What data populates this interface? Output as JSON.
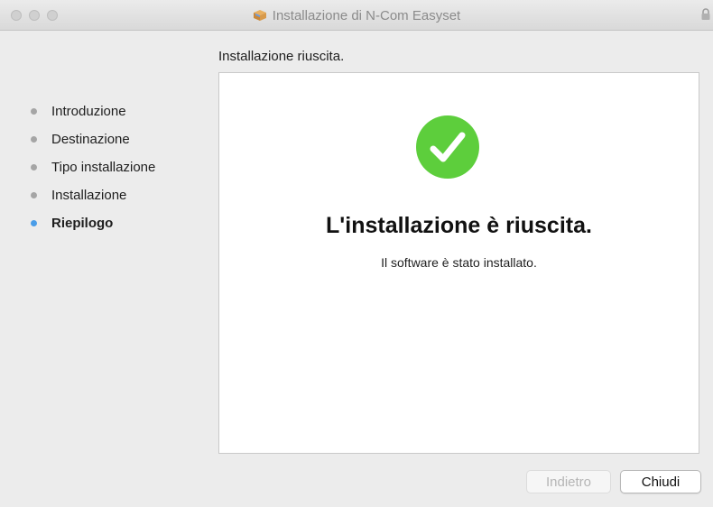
{
  "window": {
    "title": "Installazione di N-Com Easyset"
  },
  "heading": "Installazione riuscita.",
  "sidebar": {
    "steps": [
      {
        "label": "Introduzione",
        "active": false
      },
      {
        "label": "Destinazione",
        "active": false
      },
      {
        "label": "Tipo installazione",
        "active": false
      },
      {
        "label": "Installazione",
        "active": false
      },
      {
        "label": "Riepilogo",
        "active": true
      }
    ]
  },
  "content": {
    "success_title": "L'installazione è riuscita.",
    "success_message": "Il software è stato installato."
  },
  "buttons": {
    "back_label": "Indietro",
    "close_label": "Chiudi"
  },
  "colors": {
    "success_green": "#5dce3c",
    "active_step_dot": "#4a9de8",
    "inactive_step_dot": "#a5a5a5"
  },
  "icons": {
    "title_icon": "package-icon",
    "lock_icon": "lock-icon",
    "success_icon": "checkmark-icon"
  }
}
